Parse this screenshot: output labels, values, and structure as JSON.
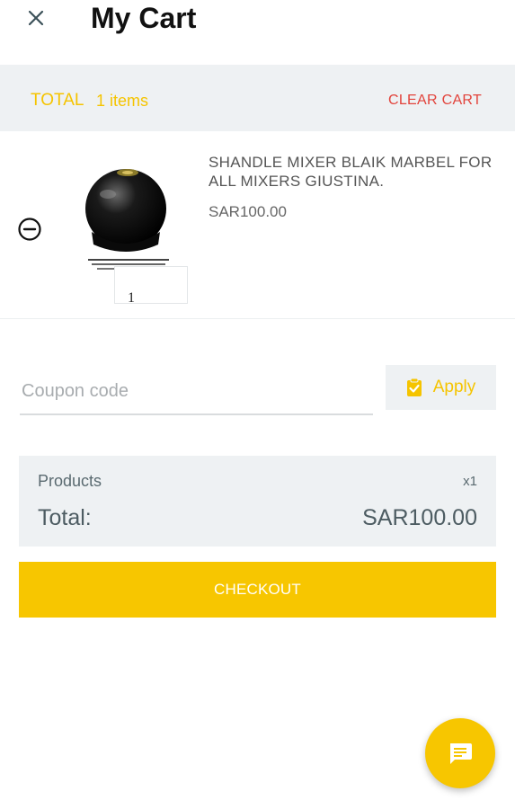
{
  "header": {
    "title": "My Cart"
  },
  "total_bar": {
    "total_label": "TOTAL",
    "items_count": "1 items",
    "clear_label": "CLEAR CART"
  },
  "cart": {
    "items": [
      {
        "name": "SHANDLE MIXER BLAIK MARBEL FOR ALL MIXERS GIUSTINA.",
        "price": "SAR100.00",
        "quantity": "1"
      }
    ]
  },
  "coupon": {
    "placeholder": "Coupon code",
    "value": "",
    "apply_label": "Apply"
  },
  "summary": {
    "products_label": "Products",
    "products_count": "x1",
    "total_label": "Total:",
    "total_value": "SAR100.00"
  },
  "checkout": {
    "label": "CHECKOUT"
  },
  "colors": {
    "accent": "#f7c600",
    "danger": "#e2433b",
    "panel": "#eef1f3"
  },
  "icons": {
    "close": "close-icon",
    "remove": "minus-circle-icon",
    "apply": "clipboard-check-icon",
    "chat": "chat-icon"
  }
}
